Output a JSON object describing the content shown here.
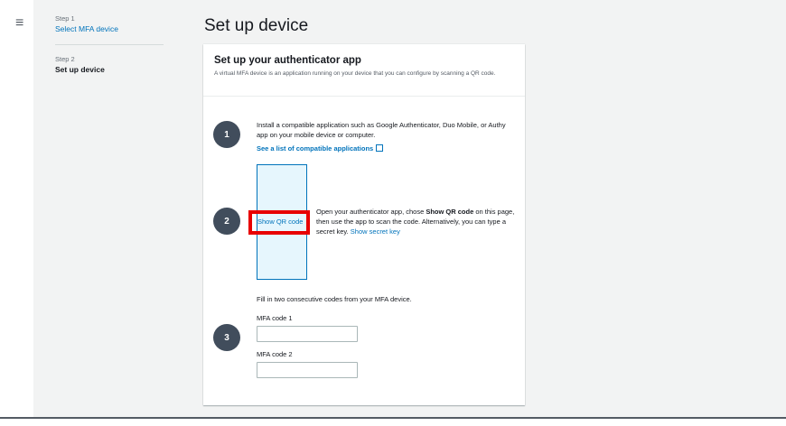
{
  "nav": {
    "menu_icon": "hamburger-icon",
    "menu_glyph": "≡"
  },
  "sidebar": {
    "steps": [
      {
        "number": "Step 1",
        "label": "Select MFA device"
      },
      {
        "number": "Step 2",
        "label": "Set up device"
      }
    ]
  },
  "page": {
    "title": "Set up device"
  },
  "panel": {
    "title": "Set up your authenticator app",
    "description": "A virtual MFA device is an application running on your device that you can configure by scanning a QR code.",
    "step1": {
      "number": "1",
      "text": "Install a compatible application such as Google Authenticator, Duo Mobile, or Authy app on your mobile device or computer.",
      "link": "See a list of compatible applications",
      "link_icon": "external-link-icon"
    },
    "step2": {
      "number": "2",
      "qr_button": "Show QR code",
      "text_before": "Open your authenticator app, chose ",
      "text_bold": "Show QR code",
      "text_after": " on this page, then use the app to scan the code. Alternatively, you can type a secret key. ",
      "secret_link": "Show secret key"
    },
    "step3": {
      "number": "3",
      "intro": "Fill in two consecutive codes from your MFA device.",
      "code1_label": "MFA code 1",
      "code1_value": "",
      "code2_label": "MFA code 2",
      "code2_value": ""
    }
  },
  "colors": {
    "accent": "#0073bb",
    "highlight": "#e80000",
    "step_circle": "#414d5c"
  }
}
